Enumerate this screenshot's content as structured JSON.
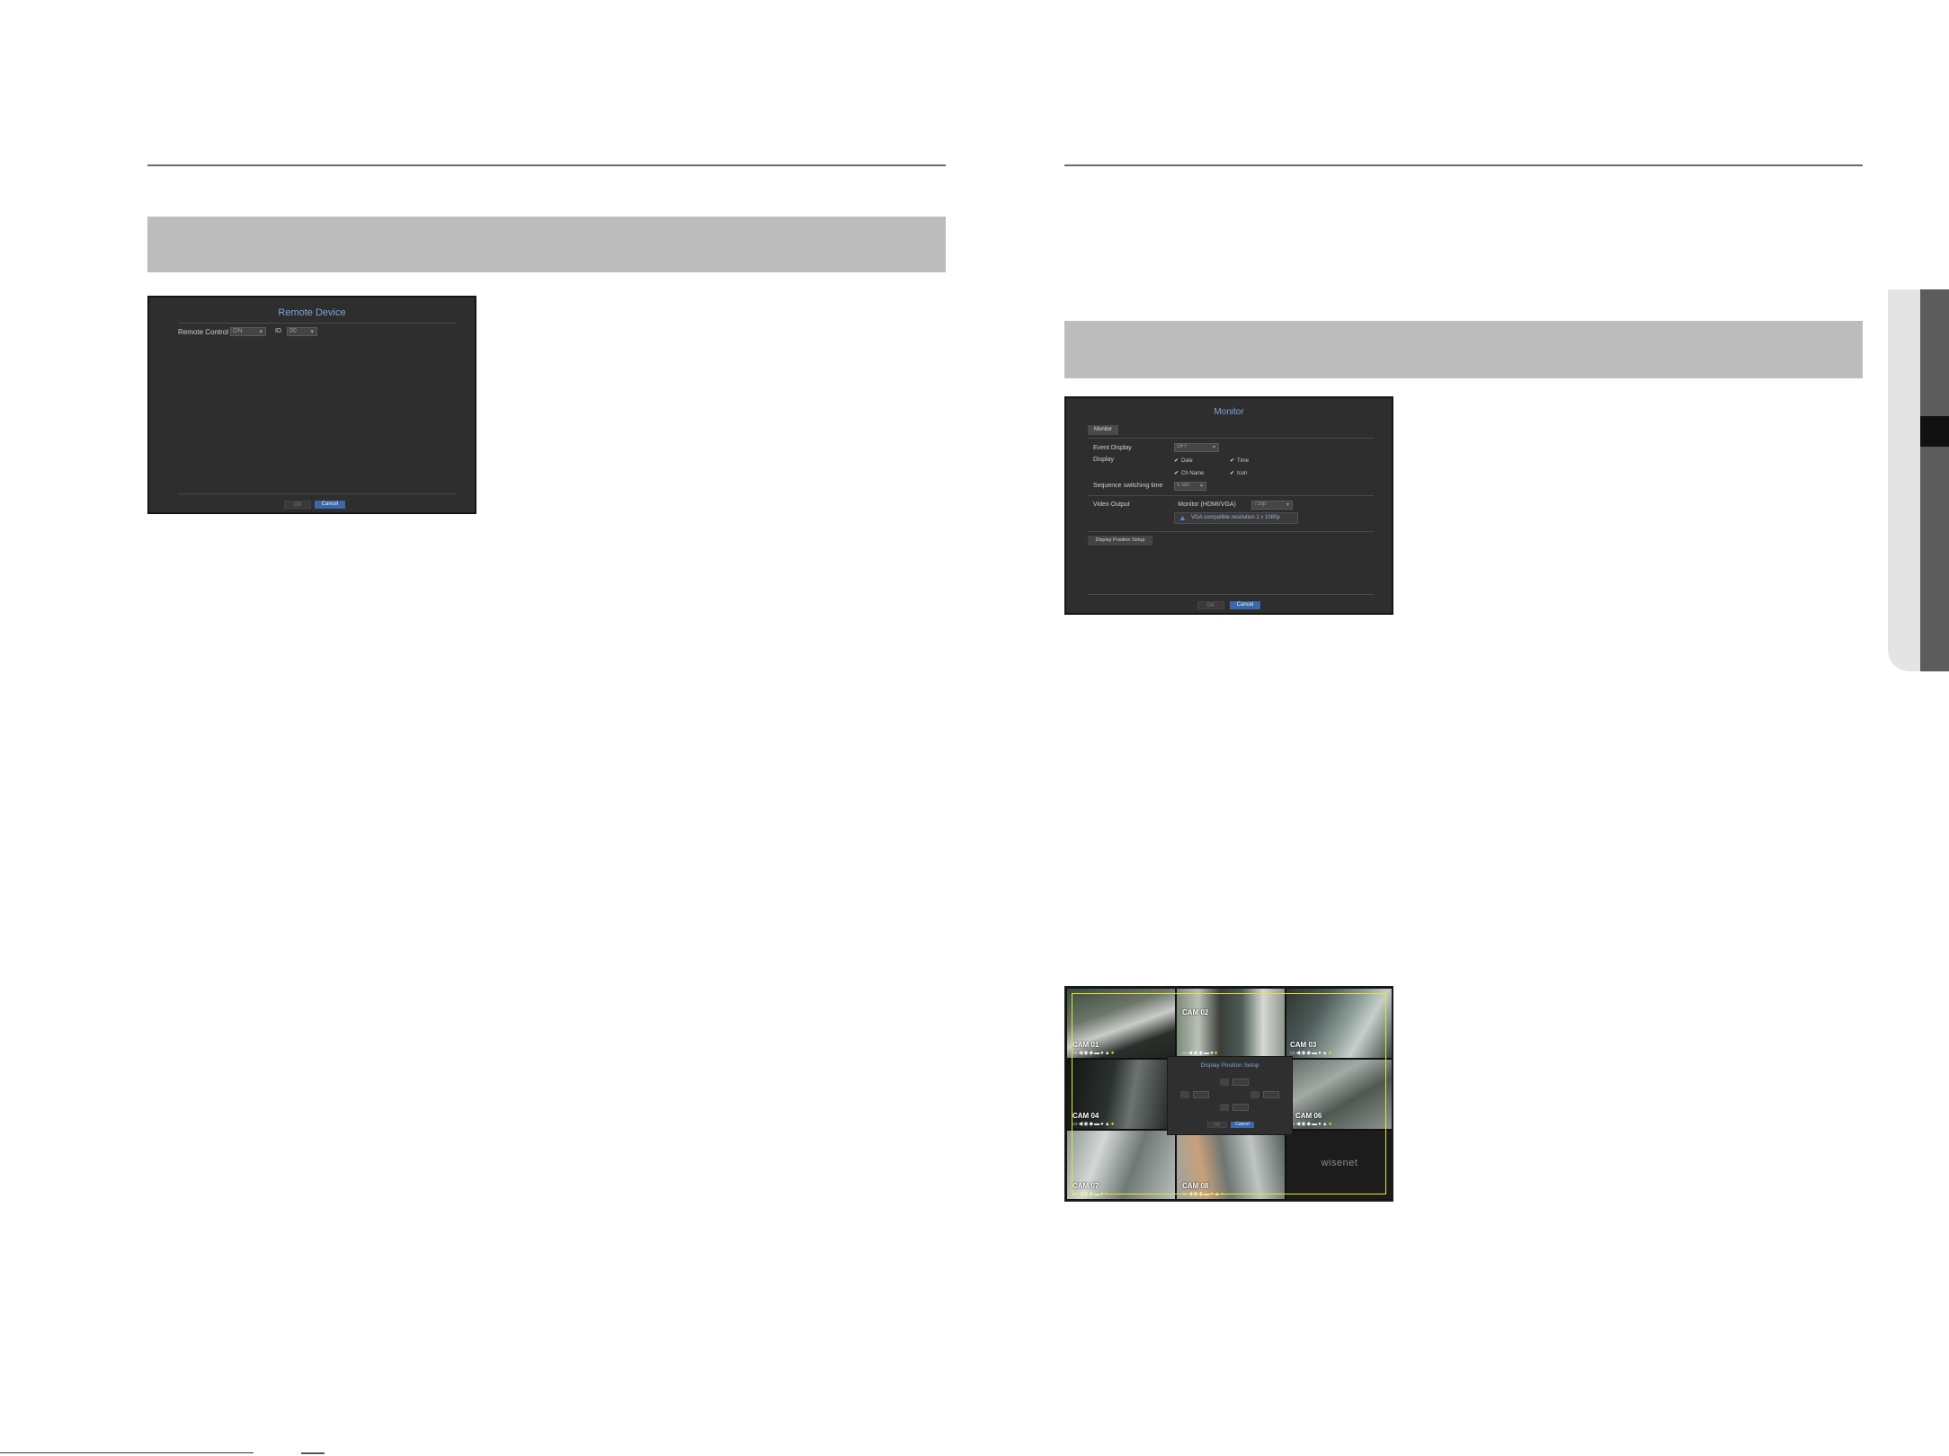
{
  "remote_device_dialog": {
    "title": "Remote Device",
    "remote_control_label": "Remote Control",
    "remote_control_value": "ON",
    "id_label": "ID",
    "id_value": "00",
    "ok_label": "OK",
    "cancel_label": "Cancel"
  },
  "monitor_dialog": {
    "title": "Monitor",
    "tab_label": "Monitor",
    "event_display_label": "Event Display",
    "event_display_value": "OFF",
    "display_label": "Display",
    "checkboxes": [
      {
        "label": "Date",
        "checked": true
      },
      {
        "label": "Time",
        "checked": true
      },
      {
        "label": "Ch Name",
        "checked": true
      },
      {
        "label": "Icon",
        "checked": true
      }
    ],
    "sequence_label": "Sequence switching time",
    "sequence_value": "5 sec",
    "video_output_label": "Video Output",
    "video_output_option": "Monitor (HDMI/VGA)",
    "resolution_value": "720p",
    "warning_text": "VGA compatible resolution 1 x 1080p",
    "display_position_button": "Display Position Setup",
    "ok_label": "OK",
    "cancel_label": "Cancel"
  },
  "camera_grid": {
    "cameras": [
      {
        "label": "CAM 01"
      },
      {
        "label": "CAM 02"
      },
      {
        "label": "CAM 03"
      },
      {
        "label": "CAM 04"
      },
      {
        "label": ""
      },
      {
        "label": "CAM 06"
      },
      {
        "label": "CAM 07"
      },
      {
        "label": "CAM 08"
      },
      {
        "label": ""
      }
    ],
    "logo_text": "wisenet",
    "popup": {
      "title": "Display Position Setup",
      "ok_label": "OK",
      "cancel_label": "Cancel"
    }
  },
  "colors": {
    "accent_blue": "#3c67a8",
    "title_blue": "#7aa6d8",
    "dialog_bg": "#2e2e2e",
    "band_gray": "#bcbcbc",
    "guide_yellow": "#e6e62a"
  }
}
